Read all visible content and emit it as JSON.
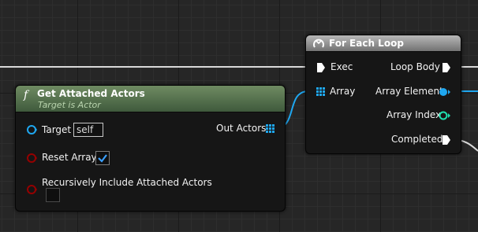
{
  "nodes": {
    "get_attached_actors": {
      "title": "Get Attached Actors",
      "subtitle": "Target is Actor",
      "icon": "function-icon",
      "header_color": "#5f7d55",
      "inputs": {
        "target": {
          "label": "Target",
          "value": "self"
        },
        "reset_array": {
          "label": "Reset Array",
          "checked": true
        },
        "recursive": {
          "label": "Recursively Include Attached Actors",
          "checked": false
        }
      },
      "outputs": {
        "out_actors": {
          "label": "Out Actors"
        }
      }
    },
    "for_each_loop": {
      "title": "For Each Loop",
      "icon": "macro-icon",
      "header_color": "#9a9a9a",
      "inputs": {
        "exec": {
          "label": "Exec"
        },
        "array": {
          "label": "Array"
        }
      },
      "outputs": {
        "loop_body": {
          "label": "Loop Body"
        },
        "array_element": {
          "label": "Array Element"
        },
        "array_index": {
          "label": "Array Index"
        },
        "completed": {
          "label": "Completed"
        }
      }
    }
  },
  "colors": {
    "object_pin": "#1fa7f0",
    "integer_pin": "#1fe0b0",
    "bool_pin": "#950000",
    "exec_pin": "#ffffff"
  }
}
